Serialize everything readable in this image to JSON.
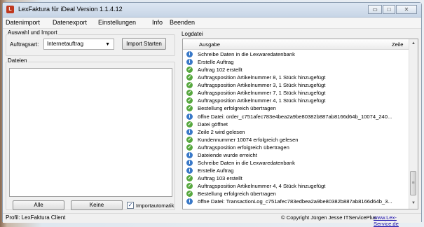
{
  "window": {
    "title": "LexFaktura für iDeal Version 1.1.4.12",
    "app_icon": "lexfaktura-app-icon",
    "controls": {
      "minimize": "▭",
      "maximize": "□",
      "close": "✕"
    }
  },
  "menu": [
    "Datenimport",
    "Datenexport",
    "Einstellungen",
    "Info",
    "Beenden"
  ],
  "import_group": {
    "label": "Auswahl und Import",
    "type_label": "Auftragsart:",
    "type_value": "Internetauftrag",
    "start_button": "Import Starten"
  },
  "files_group": {
    "label": "Dateien",
    "all_button": "Alle",
    "none_button": "Keine",
    "auto_import_label": "Importautomatik",
    "auto_import_checked": true
  },
  "log": {
    "label": "Logdatei",
    "columns": {
      "output": "Ausgabe",
      "line": "Zeile"
    },
    "rows": [
      {
        "icon": "info",
        "text": "Schreibe Daten in die Lexwaredatenbank"
      },
      {
        "icon": "info",
        "text": "Erstelle Auftrag"
      },
      {
        "icon": "ok",
        "text": "Auftrag 102 erstellt"
      },
      {
        "icon": "ok",
        "text": "Auftragsposition Artikelnummer 8, 1 Stück hinzugefügt"
      },
      {
        "icon": "ok",
        "text": "Auftragsposition Artikelnummer 3, 1 Stück hinzugefügt"
      },
      {
        "icon": "ok",
        "text": "Auftragsposition Artikelnummer 7, 1 Stück hinzugefügt"
      },
      {
        "icon": "ok",
        "text": "Auftragsposition Artikelnummer 4, 1 Stück hinzugefügt"
      },
      {
        "icon": "ok",
        "text": "Bestellung  erfolgreich übertragen"
      },
      {
        "icon": "info",
        "text": "öffne Datei: order_c751afec783e4bea2a9be80382b887ab8166d64b_10074_240..."
      },
      {
        "icon": "ok",
        "text": "Datei göffnet"
      },
      {
        "icon": "info",
        "text": "Zeile 2 wird gelesen"
      },
      {
        "icon": "ok",
        "text": "Kundennummer 10074 erfolgreich gelesen"
      },
      {
        "icon": "ok",
        "text": "Auftragsposition erfolgreich übertragen"
      },
      {
        "icon": "info",
        "text": "Dateiende wurde erreicht"
      },
      {
        "icon": "info",
        "text": "Schreibe Daten in die Lexwaredatenbank"
      },
      {
        "icon": "info",
        "text": "Erstelle Auftrag"
      },
      {
        "icon": "ok",
        "text": "Auftrag 103 erstellt"
      },
      {
        "icon": "ok",
        "text": "Auftragsposition Artikelnummer 4, 4 Stück hinzugefügt"
      },
      {
        "icon": "ok",
        "text": "Bestellung  erfolgreich übertragen"
      },
      {
        "icon": "info",
        "text": "öffne Datei: TransactionLog_c751afec783edbea2a9be80382b887ab8166d64b_3..."
      }
    ],
    "scroll_up": "▲",
    "scroll_down": "▼",
    "scroll_grip": "≡"
  },
  "status": {
    "profile": "Profil: LexFaktura Client",
    "copyright": "© Copyright Jürgen Jesse  ITServicePlus",
    "link": "www.Lex-Service.de"
  },
  "colors": {
    "info_icon": "#3a79c8",
    "ok_icon": "#57a83f",
    "link": "#1a0dab",
    "app_icon": "#c0381e"
  }
}
